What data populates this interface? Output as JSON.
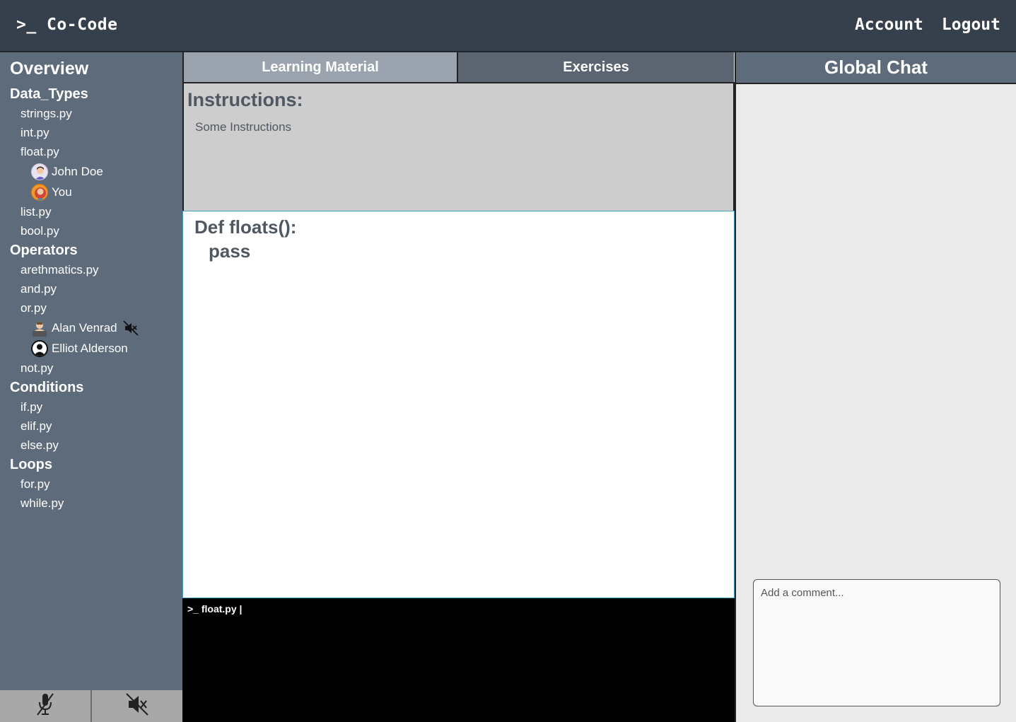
{
  "header": {
    "logo": ">_ Co-Code",
    "nav": [
      "Account",
      "Logout"
    ]
  },
  "sidebar": {
    "title": "Overview",
    "groups": [
      {
        "label": "Data_Types",
        "files": [
          {
            "name": "strings.py"
          },
          {
            "name": "int.py"
          },
          {
            "name": "float.py",
            "users": [
              {
                "name": "John Doe",
                "avatar": "male-avatar-icon"
              },
              {
                "name": "You",
                "avatar": "female-avatar-icon"
              }
            ]
          },
          {
            "name": "list.py"
          },
          {
            "name": "bool.py"
          }
        ]
      },
      {
        "label": "Operators",
        "files": [
          {
            "name": "arethmatics.py"
          },
          {
            "name": "and.py"
          },
          {
            "name": "or.py",
            "users": [
              {
                "name": "Alan Venrad",
                "avatar": "person-avatar-icon",
                "muted": true
              },
              {
                "name": "Elliot Alderson",
                "avatar": "user-silhouette-icon"
              }
            ]
          },
          {
            "name": "not.py"
          }
        ]
      },
      {
        "label": "Conditions",
        "files": [
          {
            "name": "if.py"
          },
          {
            "name": "elif.py"
          },
          {
            "name": "else.py"
          }
        ]
      },
      {
        "label": "Loops",
        "files": [
          {
            "name": "for.py"
          },
          {
            "name": "while.py"
          }
        ]
      }
    ],
    "controls": [
      "mic-muted-icon",
      "speaker-muted-icon"
    ]
  },
  "tabs": [
    {
      "label": "Learning Material",
      "active": true
    },
    {
      "label": "Exercises",
      "active": false
    }
  ],
  "instructions": {
    "title": "Instructions:",
    "text": "Some Instructions"
  },
  "editor": {
    "line1": "Def floats():",
    "line2": "pass"
  },
  "terminal": {
    "prompt": ">_ float.py  |"
  },
  "chat": {
    "title": "Global Chat",
    "placeholder": "Add a comment..."
  }
}
